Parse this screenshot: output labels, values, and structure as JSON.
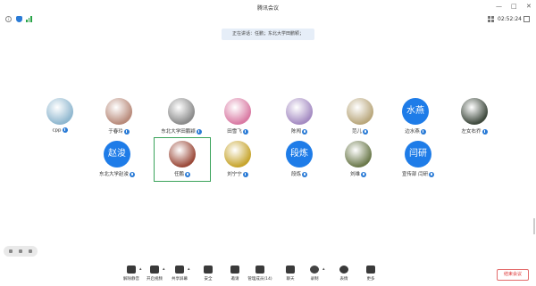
{
  "window": {
    "title": "腾讯会议",
    "clock": "02:52:24",
    "min": "—",
    "max": "□",
    "close": "✕"
  },
  "speaker_banner": "正在讲话：任鹏；东北大学田鹏颖；",
  "participants": [
    {
      "name": "cpp",
      "avatar": "image",
      "color": "#8fb7cf"
    },
    {
      "name": "于春玲",
      "avatar": "image",
      "color": "#b88a7a"
    },
    {
      "name": "东北大学田鹏颖",
      "avatar": "image",
      "color": "#8b8b8b"
    },
    {
      "name": "田雪飞",
      "avatar": "image",
      "color": "#d97aa3"
    },
    {
      "name": "陈闯",
      "avatar": "image",
      "color": "#a48bc2"
    },
    {
      "name": "范儿",
      "avatar": "image",
      "color": "#b9a77c"
    },
    {
      "name": "边水燕",
      "avatar": "text",
      "initials": "水燕"
    },
    {
      "name": "左女右乔",
      "avatar": "image",
      "color": "#3f4a3e"
    },
    {
      "name": "东北大学赵浚",
      "avatar": "text",
      "initials": "赵浚"
    },
    {
      "name": "任鹏",
      "avatar": "image",
      "color": "#9b4a3a"
    },
    {
      "name": "刘宁宁",
      "avatar": "image",
      "color": "#c7a52e"
    },
    {
      "name": "段炼",
      "avatar": "text",
      "initials": "段炼"
    },
    {
      "name": "刘维",
      "avatar": "image",
      "color": "#6c7a4c"
    },
    {
      "name": "宣传部 闫研",
      "avatar": "text",
      "initials": "闫研"
    }
  ],
  "toolbar": [
    {
      "label": "解除静音",
      "icon": "mic-icon",
      "caret": true
    },
    {
      "label": "开启视频",
      "icon": "camera-icon",
      "caret": true
    },
    {
      "label": "共享屏幕",
      "icon": "share-screen-icon",
      "caret": true
    },
    {
      "label": "安全",
      "icon": "shield-icon"
    },
    {
      "label": "邀请",
      "icon": "invite-icon"
    },
    {
      "label": "管理成员(14)",
      "icon": "members-icon"
    },
    {
      "label": "聊天",
      "icon": "chat-icon"
    },
    {
      "label": "录制",
      "icon": "record-icon",
      "caret": true
    },
    {
      "label": "表情",
      "icon": "emoji-icon"
    },
    {
      "label": "更多",
      "icon": "more-icon"
    }
  ],
  "leave_label": "结束会议"
}
